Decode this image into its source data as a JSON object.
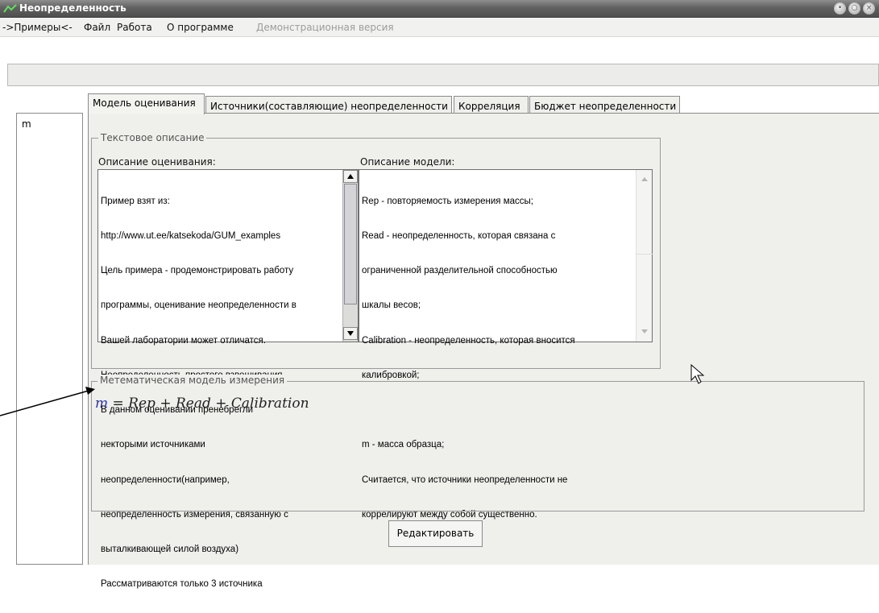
{
  "window": {
    "title": "Неопределенность",
    "icon": "app-wave-icon",
    "controls": [
      "minimize-icon",
      "maximize-icon",
      "close-icon"
    ]
  },
  "menu": [
    {
      "label": "->Примеры<-",
      "enabled": true
    },
    {
      "label": "Файл",
      "enabled": true
    },
    {
      "label": "Работа",
      "enabled": true
    },
    {
      "label": "О программе",
      "enabled": true
    },
    {
      "label": "Демонстрационная версия",
      "enabled": false
    }
  ],
  "left_list": {
    "items": [
      "m"
    ]
  },
  "tabs": [
    {
      "label": "Модель оценивания",
      "active": true
    },
    {
      "label": "Источники(составляющие) неопределенности",
      "active": false
    },
    {
      "label": "Корреляция",
      "active": false
    },
    {
      "label": "Бюджет неопределенности",
      "active": false
    }
  ],
  "text_description": {
    "title": "Текстовое описание",
    "evaluation_label": "Описание оценивания:",
    "evaluation_lines": [
      "Пример взят из:",
      "http://www.ut.ee/katsekoda/GUM_examples",
      "Цель примера - продемонстрировать работу",
      "программы, оценивание неопределенности в",
      "Вашей лаборатории может отличатся.",
      "Неопределенность простого взвешивания",
      "В данном оценивании пренебрегли",
      "некторыми источниками",
      "неопределенности(например,",
      "неопределенность измерения, связанную с",
      "выталкивающей силой воздуха)",
      "Рассматриваются только 3 источника"
    ],
    "model_label": "Описание модели:",
    "model_lines": [
      "Rep - повторяемость измерения массы;",
      "Read - неопределенность, которая связана с",
      "ограниченной разделительной способностью",
      "шкалы весов;",
      "Calibration - неопределенность, которая вносится",
      "калибровкой;",
      "",
      "m - масса образца;",
      "Считается, что источники неопределенности не",
      "коррелируют между собой существенно."
    ]
  },
  "math_model": {
    "title": "Метематическая модель измерения",
    "lhs": "m",
    "rhs": "= Rep + Read + Calibration"
  },
  "edit_button": {
    "label": "Редактировать"
  },
  "colors": {
    "titlebar": "#5a5a5a",
    "pane_bg": "#efefec",
    "formula_var": "#2633b0"
  }
}
